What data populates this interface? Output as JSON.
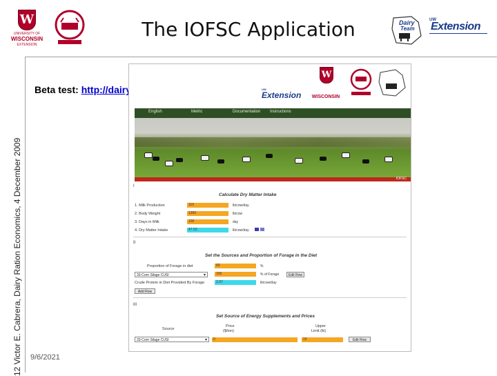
{
  "slide": {
    "title": "The IOFSC Application",
    "side_text": "12     Victor E. Cabrera, Dairy Ration Economics, 4 December 2009",
    "beta_label": "Beta test:",
    "beta_url": "http://dairymgt.info/web/",
    "date": "9/6/2021"
  },
  "logos": {
    "wisconsin": "WISCONSIN",
    "dairy_team_1": "Dairy",
    "dairy_team_2": "Team",
    "extension": "Extension",
    "uw_small": "UW"
  },
  "app": {
    "nav": [
      "English",
      "Metric",
      "Documentation",
      "Instructions"
    ],
    "banner_tag": "IOFSC",
    "section1": {
      "num": "I",
      "title": "Calculate Dry Matter Intake",
      "rows": [
        {
          "label": "1.  Milk Production",
          "value": "110",
          "unit": "lb/cow/day"
        },
        {
          "label": "2.  Body Weight",
          "value": "1300",
          "unit": "lb/cow"
        },
        {
          "label": "3.  Days in Milk",
          "value": "100",
          "unit": "day"
        },
        {
          "label": "4.  Dry Matter Intake",
          "value": "47.53",
          "unit": "lb/cow/day"
        }
      ]
    },
    "section2": {
      "num": "II",
      "title": "Set the Sources and Proportion of Forage in the Diet",
      "proportion_label": "Proportion of Forage in diet",
      "proportion_value": "60",
      "proportion_unit": "%",
      "source_select": "33-Corn Silage CUSI",
      "source_value": "100",
      "source_unit": "% of Forage",
      "edit_row": "Edit Row",
      "cp_label": "Crude Protein in Diet Provided By Forage",
      "cp_value": "2.97",
      "cp_unit": "lb/cow/day",
      "add_row": "Add Row"
    },
    "section3": {
      "num": "III",
      "title": "Set Source of Energy Supplements and Prices",
      "col_source": "Source",
      "col_price": "Price",
      "col_price_unit": "($/ton)",
      "col_upper": "Upper",
      "col_upper_unit": "Limit (lb)",
      "select": "33-Corn Silage CUSI",
      "price": "0",
      "upper": "15",
      "edit_row": "Edit Row"
    }
  }
}
